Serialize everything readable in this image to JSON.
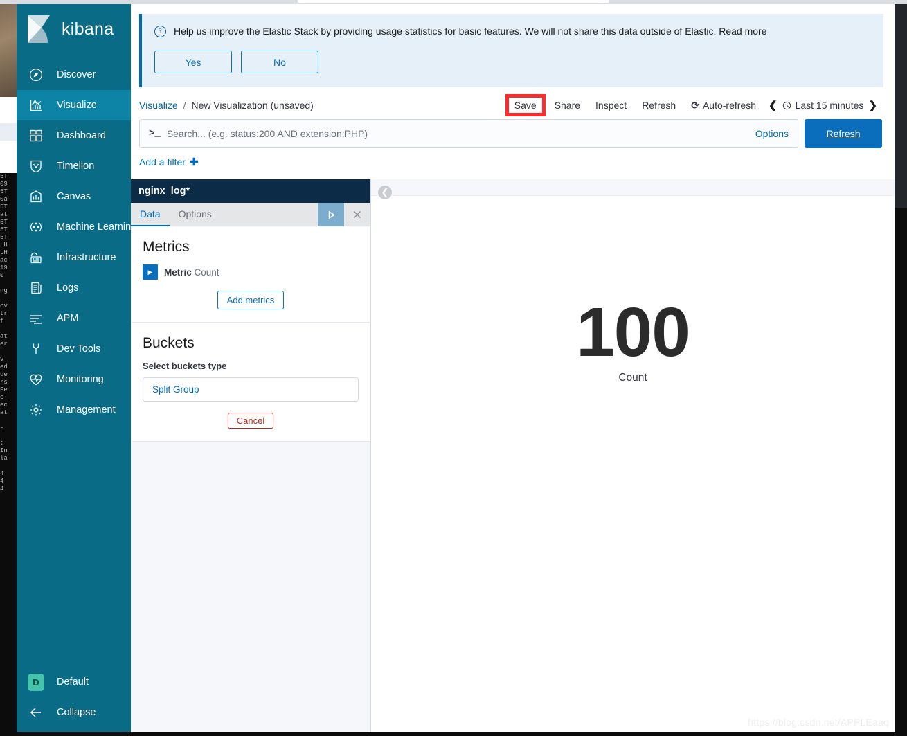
{
  "app": {
    "brand": "kibana"
  },
  "sidebar": {
    "items": [
      {
        "label": "Discover",
        "icon": "compass-icon",
        "active": false
      },
      {
        "label": "Visualize",
        "icon": "bar-chart-icon",
        "active": true
      },
      {
        "label": "Dashboard",
        "icon": "dashboard-grid-icon",
        "active": false
      },
      {
        "label": "Timelion",
        "icon": "timelion-shield-icon",
        "active": false
      },
      {
        "label": "Canvas",
        "icon": "canvas-icon",
        "active": false
      },
      {
        "label": "Machine Learning",
        "icon": "ml-nodes-icon",
        "active": false
      },
      {
        "label": "Infrastructure",
        "icon": "infrastructure-icon",
        "active": false
      },
      {
        "label": "Logs",
        "icon": "logs-document-icon",
        "active": false
      },
      {
        "label": "APM",
        "icon": "apm-lines-icon",
        "active": false
      },
      {
        "label": "Dev Tools",
        "icon": "wrench-icon",
        "active": false
      },
      {
        "label": "Monitoring",
        "icon": "heartbeat-icon",
        "active": false
      },
      {
        "label": "Management",
        "icon": "gear-icon",
        "active": false
      }
    ],
    "space": {
      "initial": "D",
      "label": "Default"
    },
    "collapse_label": "Collapse"
  },
  "banner": {
    "text": "Help us improve the Elastic Stack by providing usage statistics for basic features. We will not share this data outside of Elastic. Read more",
    "yes_label": "Yes",
    "no_label": "No",
    "accent": "#006bb4"
  },
  "breadcrumb": {
    "root": "Visualize",
    "separator": "/",
    "current": "New Visualization (unsaved)"
  },
  "toolbar": {
    "save_label": "Save",
    "share_label": "Share",
    "inspect_label": "Inspect",
    "refresh_label": "Refresh",
    "autorefresh_label": "Auto-refresh",
    "timepicker_label": "Last 15 minutes",
    "highlight_color": "#fc2d2d"
  },
  "query": {
    "prompt": ">_",
    "placeholder": "Search... (e.g. status:200 AND extension:PHP)",
    "value": "",
    "options_label": "Options",
    "refresh_label": "Refresh"
  },
  "filters": {
    "add_label": "Add a filter"
  },
  "editor": {
    "index_pattern": "nginx_log*",
    "tabs": [
      {
        "label": "Data",
        "active": true
      },
      {
        "label": "Options",
        "active": false
      }
    ],
    "metrics": {
      "heading": "Metrics",
      "rows": [
        {
          "type": "Metric",
          "agg": "Count"
        }
      ],
      "add_label": "Add metrics"
    },
    "buckets": {
      "heading": "Buckets",
      "select_label": "Select buckets type",
      "selected": "Split Group",
      "cancel_label": "Cancel"
    }
  },
  "visualization": {
    "type": "metric",
    "value": "100",
    "label": "Count"
  },
  "watermark": "https://blog.csdn.net/APPLEaaq"
}
